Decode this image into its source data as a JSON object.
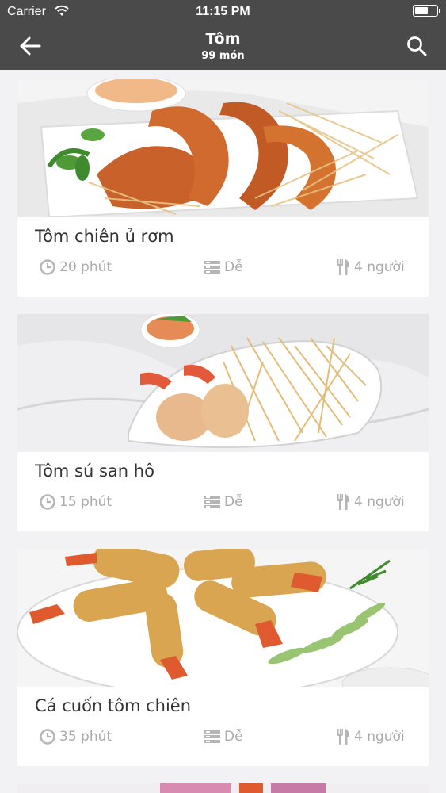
{
  "status_bar": {
    "carrier": "Carrier",
    "time": "11:15 PM",
    "battery_level": 0.6
  },
  "nav": {
    "title": "Tôm",
    "subtitle": "99 món",
    "back_icon": "arrow-left-icon",
    "search_icon": "search-icon"
  },
  "recipes": [
    {
      "title": "Tôm chiên ủ rơm",
      "time": "20 phút",
      "difficulty": "Dễ",
      "servings": "4 người"
    },
    {
      "title": "Tôm sú san hô",
      "time": "15 phút",
      "difficulty": "Dễ",
      "servings": "4 người"
    },
    {
      "title": "Cá cuốn tôm chiên",
      "time": "35 phút",
      "difficulty": "Dễ",
      "servings": "4 người"
    }
  ],
  "colors": {
    "header_bg": "#4a4a4a",
    "page_bg": "#f2f2f4",
    "meta_text": "#aaaaaa",
    "title_text": "#333333"
  }
}
